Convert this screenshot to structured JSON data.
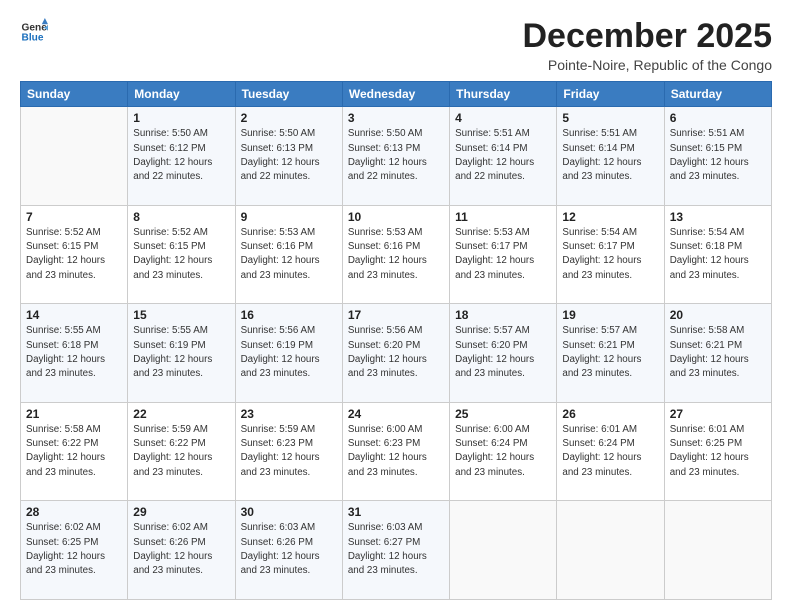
{
  "logo": {
    "line1": "General",
    "line2": "Blue"
  },
  "title": "December 2025",
  "location": "Pointe-Noire, Republic of the Congo",
  "days_header": [
    "Sunday",
    "Monday",
    "Tuesday",
    "Wednesday",
    "Thursday",
    "Friday",
    "Saturday"
  ],
  "weeks": [
    [
      {
        "num": "",
        "info": ""
      },
      {
        "num": "1",
        "info": "Sunrise: 5:50 AM\nSunset: 6:12 PM\nDaylight: 12 hours\nand 22 minutes."
      },
      {
        "num": "2",
        "info": "Sunrise: 5:50 AM\nSunset: 6:13 PM\nDaylight: 12 hours\nand 22 minutes."
      },
      {
        "num": "3",
        "info": "Sunrise: 5:50 AM\nSunset: 6:13 PM\nDaylight: 12 hours\nand 22 minutes."
      },
      {
        "num": "4",
        "info": "Sunrise: 5:51 AM\nSunset: 6:14 PM\nDaylight: 12 hours\nand 22 minutes."
      },
      {
        "num": "5",
        "info": "Sunrise: 5:51 AM\nSunset: 6:14 PM\nDaylight: 12 hours\nand 23 minutes."
      },
      {
        "num": "6",
        "info": "Sunrise: 5:51 AM\nSunset: 6:15 PM\nDaylight: 12 hours\nand 23 minutes."
      }
    ],
    [
      {
        "num": "7",
        "info": "Sunrise: 5:52 AM\nSunset: 6:15 PM\nDaylight: 12 hours\nand 23 minutes."
      },
      {
        "num": "8",
        "info": "Sunrise: 5:52 AM\nSunset: 6:15 PM\nDaylight: 12 hours\nand 23 minutes."
      },
      {
        "num": "9",
        "info": "Sunrise: 5:53 AM\nSunset: 6:16 PM\nDaylight: 12 hours\nand 23 minutes."
      },
      {
        "num": "10",
        "info": "Sunrise: 5:53 AM\nSunset: 6:16 PM\nDaylight: 12 hours\nand 23 minutes."
      },
      {
        "num": "11",
        "info": "Sunrise: 5:53 AM\nSunset: 6:17 PM\nDaylight: 12 hours\nand 23 minutes."
      },
      {
        "num": "12",
        "info": "Sunrise: 5:54 AM\nSunset: 6:17 PM\nDaylight: 12 hours\nand 23 minutes."
      },
      {
        "num": "13",
        "info": "Sunrise: 5:54 AM\nSunset: 6:18 PM\nDaylight: 12 hours\nand 23 minutes."
      }
    ],
    [
      {
        "num": "14",
        "info": "Sunrise: 5:55 AM\nSunset: 6:18 PM\nDaylight: 12 hours\nand 23 minutes."
      },
      {
        "num": "15",
        "info": "Sunrise: 5:55 AM\nSunset: 6:19 PM\nDaylight: 12 hours\nand 23 minutes."
      },
      {
        "num": "16",
        "info": "Sunrise: 5:56 AM\nSunset: 6:19 PM\nDaylight: 12 hours\nand 23 minutes."
      },
      {
        "num": "17",
        "info": "Sunrise: 5:56 AM\nSunset: 6:20 PM\nDaylight: 12 hours\nand 23 minutes."
      },
      {
        "num": "18",
        "info": "Sunrise: 5:57 AM\nSunset: 6:20 PM\nDaylight: 12 hours\nand 23 minutes."
      },
      {
        "num": "19",
        "info": "Sunrise: 5:57 AM\nSunset: 6:21 PM\nDaylight: 12 hours\nand 23 minutes."
      },
      {
        "num": "20",
        "info": "Sunrise: 5:58 AM\nSunset: 6:21 PM\nDaylight: 12 hours\nand 23 minutes."
      }
    ],
    [
      {
        "num": "21",
        "info": "Sunrise: 5:58 AM\nSunset: 6:22 PM\nDaylight: 12 hours\nand 23 minutes."
      },
      {
        "num": "22",
        "info": "Sunrise: 5:59 AM\nSunset: 6:22 PM\nDaylight: 12 hours\nand 23 minutes."
      },
      {
        "num": "23",
        "info": "Sunrise: 5:59 AM\nSunset: 6:23 PM\nDaylight: 12 hours\nand 23 minutes."
      },
      {
        "num": "24",
        "info": "Sunrise: 6:00 AM\nSunset: 6:23 PM\nDaylight: 12 hours\nand 23 minutes."
      },
      {
        "num": "25",
        "info": "Sunrise: 6:00 AM\nSunset: 6:24 PM\nDaylight: 12 hours\nand 23 minutes."
      },
      {
        "num": "26",
        "info": "Sunrise: 6:01 AM\nSunset: 6:24 PM\nDaylight: 12 hours\nand 23 minutes."
      },
      {
        "num": "27",
        "info": "Sunrise: 6:01 AM\nSunset: 6:25 PM\nDaylight: 12 hours\nand 23 minutes."
      }
    ],
    [
      {
        "num": "28",
        "info": "Sunrise: 6:02 AM\nSunset: 6:25 PM\nDaylight: 12 hours\nand 23 minutes."
      },
      {
        "num": "29",
        "info": "Sunrise: 6:02 AM\nSunset: 6:26 PM\nDaylight: 12 hours\nand 23 minutes."
      },
      {
        "num": "30",
        "info": "Sunrise: 6:03 AM\nSunset: 6:26 PM\nDaylight: 12 hours\nand 23 minutes."
      },
      {
        "num": "31",
        "info": "Sunrise: 6:03 AM\nSunset: 6:27 PM\nDaylight: 12 hours\nand 23 minutes."
      },
      {
        "num": "",
        "info": ""
      },
      {
        "num": "",
        "info": ""
      },
      {
        "num": "",
        "info": ""
      }
    ]
  ]
}
